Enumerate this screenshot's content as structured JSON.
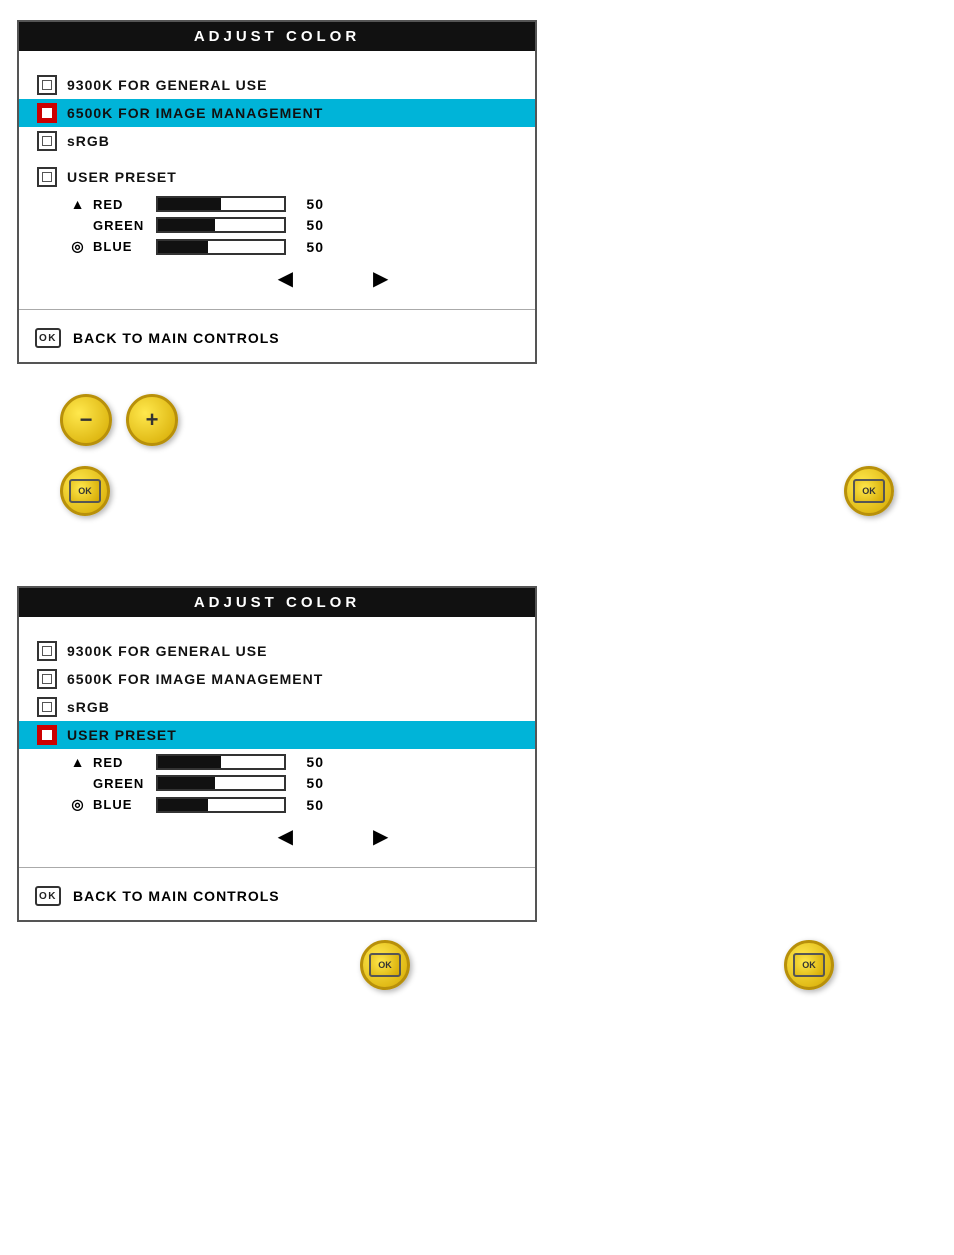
{
  "panel1": {
    "title": "ADJUST COLOR",
    "items": [
      {
        "id": "9300k",
        "label": "9300K FOR GENERAL USE",
        "highlighted": false,
        "icon": "square"
      },
      {
        "id": "6500k",
        "label": "6500K FOR IMAGE MANAGEMENT",
        "highlighted": true,
        "icon": "red-square"
      },
      {
        "id": "srgb",
        "label": "sRGB",
        "highlighted": false,
        "icon": "square"
      }
    ],
    "user_preset": {
      "label": "USER PRESET",
      "highlighted": false,
      "icon": "square",
      "sliders": [
        {
          "id": "red",
          "label": "RED",
          "icon": "▲",
          "value": 50,
          "fill": 50
        },
        {
          "id": "green",
          "label": "GREEN",
          "icon": "",
          "value": 50,
          "fill": 45
        },
        {
          "id": "blue",
          "label": "BLUE",
          "icon": "◎",
          "value": 50,
          "fill": 40
        }
      ],
      "nav_left": "◀",
      "nav_right": "▶"
    },
    "back_label": "BACK TO MAIN CONTROLS",
    "ok_label": "OK"
  },
  "minus_btn": "−",
  "plus_btn": "+",
  "panel2": {
    "title": "ADJUST COLOR",
    "items": [
      {
        "id": "9300k",
        "label": "9300K FOR GENERAL USE",
        "highlighted": false,
        "icon": "square"
      },
      {
        "id": "6500k",
        "label": "6500K FOR IMAGE MANAGEMENT",
        "highlighted": false,
        "icon": "square"
      },
      {
        "id": "srgb",
        "label": "sRGB",
        "highlighted": false,
        "icon": "square"
      }
    ],
    "user_preset": {
      "label": "USER PRESET",
      "highlighted": true,
      "icon": "red-square",
      "sliders": [
        {
          "id": "red",
          "label": "RED",
          "icon": "▲",
          "value": 50,
          "fill": 50
        },
        {
          "id": "green",
          "label": "GREEN",
          "icon": "",
          "value": 50,
          "fill": 45
        },
        {
          "id": "blue",
          "label": "BLUE",
          "icon": "◎",
          "value": 50,
          "fill": 40
        }
      ],
      "nav_left": "◀",
      "nav_right": "▶"
    },
    "back_label": "BACK TO MAIN CONTROLS",
    "ok_label": "OK"
  }
}
